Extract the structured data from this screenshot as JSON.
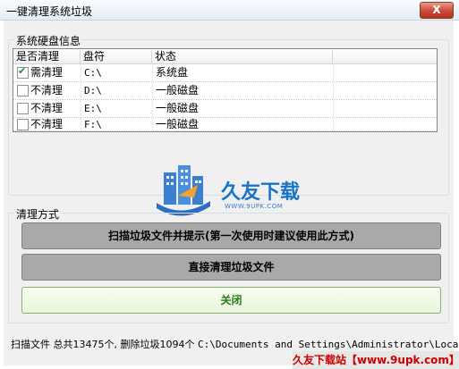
{
  "window": {
    "title": "一键清理系统垃圾",
    "close_label": "X"
  },
  "disk_group": {
    "label": "系统硬盘信息",
    "columns": [
      "是否清理",
      "盘符",
      "状态"
    ],
    "rows": [
      {
        "checked": true,
        "clean": "需清理",
        "drive": "C:\\",
        "status": "系统盘"
      },
      {
        "checked": false,
        "clean": "不清理",
        "drive": "D:\\",
        "status": "一般磁盘"
      },
      {
        "checked": false,
        "clean": "不清理",
        "drive": "E:\\",
        "status": "一般磁盘"
      },
      {
        "checked": false,
        "clean": "不清理",
        "drive": "F:\\",
        "status": "一般磁盘"
      }
    ]
  },
  "logo": {
    "text": "久友下载",
    "url": "WWW.9UPK.COM"
  },
  "clean_group": {
    "label": "清理方式",
    "scan_button": "扫描垃圾文件并提示(第一次使用时建议使用此方式)",
    "direct_button": "直接清理垃圾文件",
    "close_button": "关闭"
  },
  "status_bar": {
    "text": "扫描文件 总共13475个, 删除垃圾1094个",
    "path": "C:\\Documents and Settings\\Administrator\\Local"
  },
  "watermark": {
    "text": "久友下载站【www.9upk.com】"
  },
  "colors": {
    "accent_green": "#2a8a2a",
    "logo_text": "#1a73c8",
    "watermark_text": "#cc0000"
  }
}
